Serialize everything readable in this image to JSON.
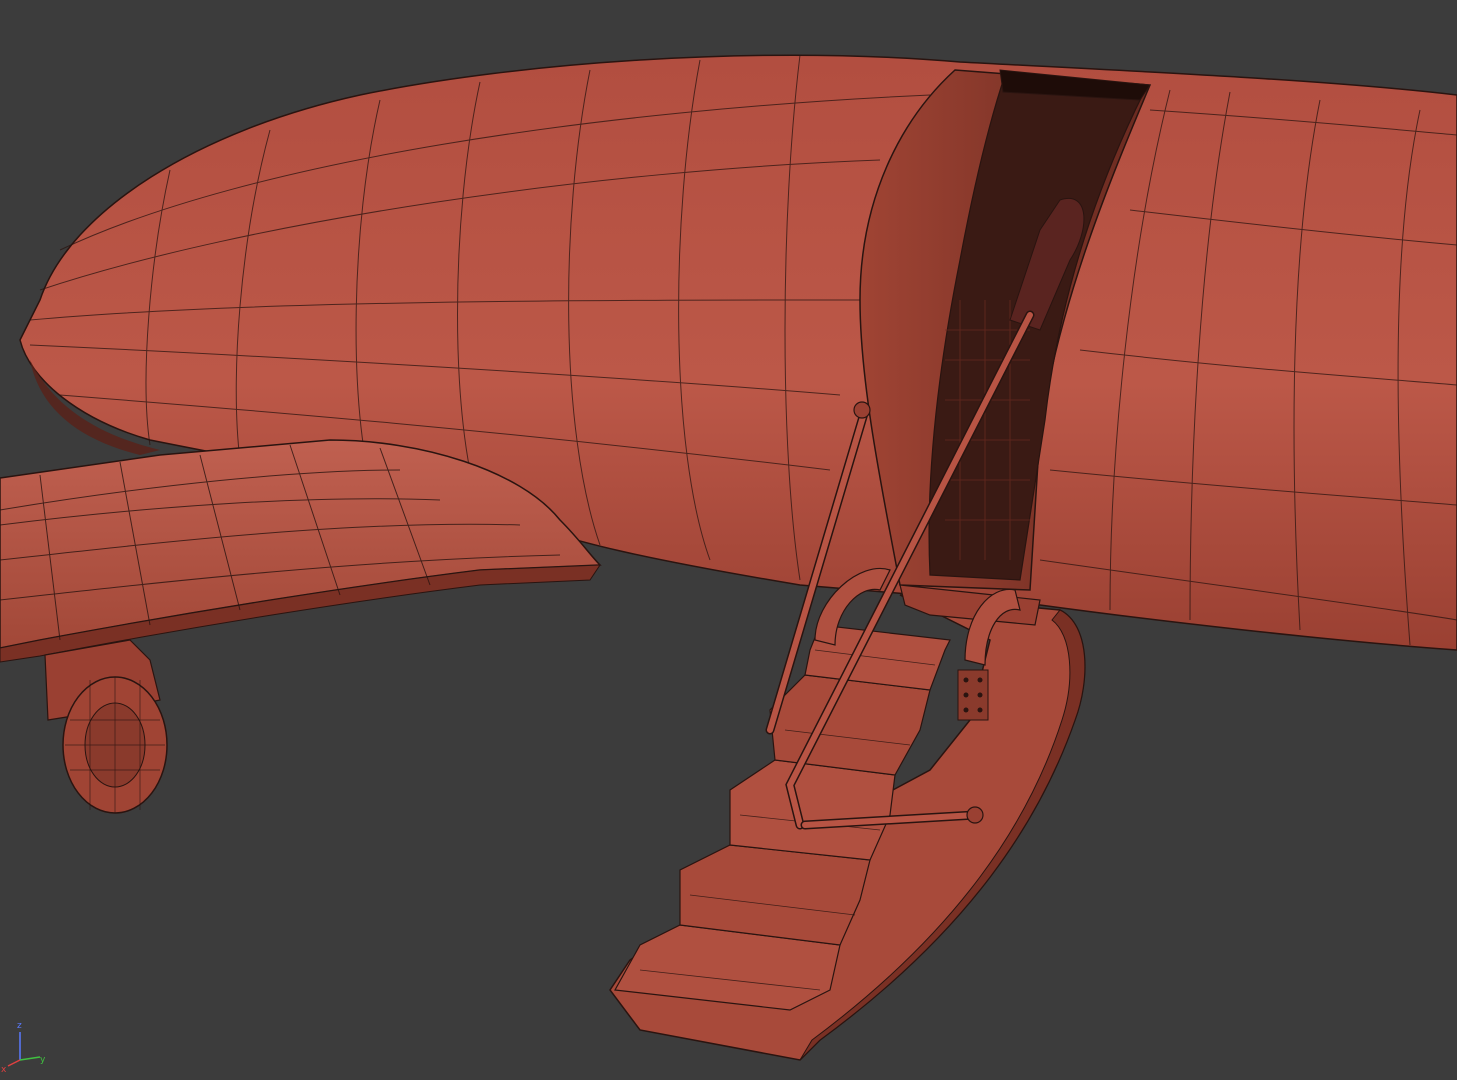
{
  "viewport": {
    "background_color": "#3c3c3c",
    "shading_color": "#b85444",
    "shadow_color": "#7a3024",
    "wire_color": "#2a1410",
    "interior_color": "#3a1a14"
  },
  "axis_gizmo": {
    "z_label": "z",
    "x_label": "x",
    "y_label": "y",
    "z_color": "#5a7aff",
    "x_color": "#e04040",
    "y_color": "#40c040"
  }
}
